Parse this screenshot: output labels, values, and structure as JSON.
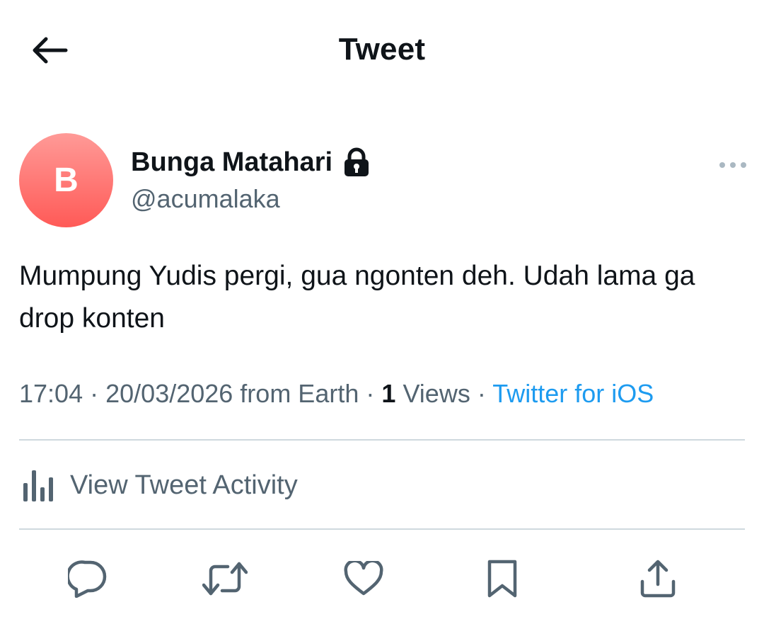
{
  "header": {
    "title": "Tweet",
    "back_icon": "arrow-left-icon"
  },
  "author": {
    "avatar_initial": "B",
    "name": "Bunga Matahari",
    "handle": "@acumalaka",
    "protected_icon": "lock-icon",
    "avatar_colors": [
      "#ff9a97",
      "#ff5a57"
    ]
  },
  "tweet": {
    "text": "Mumpung Yudis pergi, gua ngonten deh. Udah lama ga drop konten"
  },
  "meta": {
    "time": "17:04",
    "separator": "·",
    "date_location": "20/03/2026 from Earth",
    "views_count": "1",
    "views_label": "Views",
    "source": "Twitter for iOS"
  },
  "activity": {
    "label": "View Tweet Activity",
    "icon": "bar-chart-icon"
  },
  "actions": [
    "reply-icon",
    "retweet-icon",
    "like-icon",
    "bookmark-icon",
    "share-icon"
  ],
  "colors": {
    "text_primary": "#0f1419",
    "text_secondary": "#536471",
    "link": "#1d9bf0",
    "divider": "#cfd9de"
  }
}
